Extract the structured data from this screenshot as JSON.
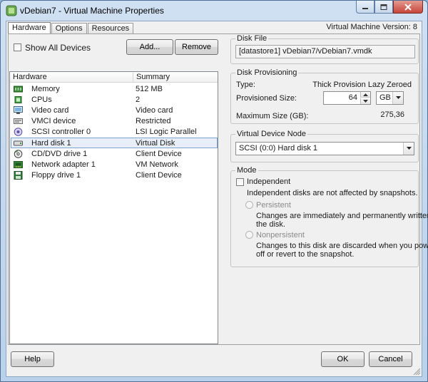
{
  "window": {
    "title": "vDebian7 - Virtual Machine Properties",
    "buttons": {
      "minimize": "minimize-icon",
      "maximize": "maximize-icon",
      "close": "close-icon"
    }
  },
  "tabs": [
    {
      "label": "Hardware"
    },
    {
      "label": "Options"
    },
    {
      "label": "Resources"
    }
  ],
  "vm_version": "Virtual Machine Version: 8",
  "left": {
    "show_all_devices_label": "Show All Devices",
    "add_label": "Add...",
    "remove_label": "Remove",
    "columns": {
      "hardware": "Hardware",
      "summary": "Summary"
    },
    "devices": [
      {
        "name": "Memory",
        "summary": "512 MB",
        "icon": "memory-icon"
      },
      {
        "name": "CPUs",
        "summary": "2",
        "icon": "cpu-icon"
      },
      {
        "name": "Video card",
        "summary": "Video card",
        "icon": "monitor-icon"
      },
      {
        "name": "VMCI device",
        "summary": "Restricted",
        "icon": "vmci-icon"
      },
      {
        "name": "SCSI controller 0",
        "summary": "LSI Logic Parallel",
        "icon": "scsi-controller-icon"
      },
      {
        "name": "Hard disk 1",
        "summary": "Virtual Disk",
        "icon": "hard-disk-icon"
      },
      {
        "name": "CD/DVD drive 1",
        "summary": "Client Device",
        "icon": "cd-dvd-icon"
      },
      {
        "name": "Network adapter 1",
        "summary": "VM Network",
        "icon": "network-adapter-icon"
      },
      {
        "name": "Floppy drive 1",
        "summary": "Client Device",
        "icon": "floppy-icon"
      }
    ]
  },
  "disk_file": {
    "title": "Disk File",
    "value": "[datastore1] vDebian7/vDebian7.vmdk"
  },
  "disk_provisioning": {
    "title": "Disk Provisioning",
    "type_label": "Type:",
    "type_value": "Thick Provision Lazy Zeroed",
    "provisioned_size_label": "Provisioned Size:",
    "provisioned_size_value": "64",
    "unit": "GB",
    "max_size_label": "Maximum Size (GB):",
    "max_size_value": "275,36"
  },
  "device_node": {
    "title": "Virtual Device Node",
    "value": "SCSI (0:0) Hard disk 1"
  },
  "mode": {
    "title": "Mode",
    "independent_label": "Independent",
    "independent_desc": "Independent disks are not affected by snapshots.",
    "persistent_label": "Persistent",
    "persistent_desc_1": "Changes are immediately and permanently written to",
    "persistent_desc_2": "the disk.",
    "nonpersistent_label": "Nonpersistent",
    "nonpersistent_desc_1": "Changes to this disk are discarded when you power",
    "nonpersistent_desc_2": "off or revert to the snapshot."
  },
  "footer": {
    "help_label": "Help",
    "ok_label": "OK",
    "cancel_label": "Cancel"
  }
}
